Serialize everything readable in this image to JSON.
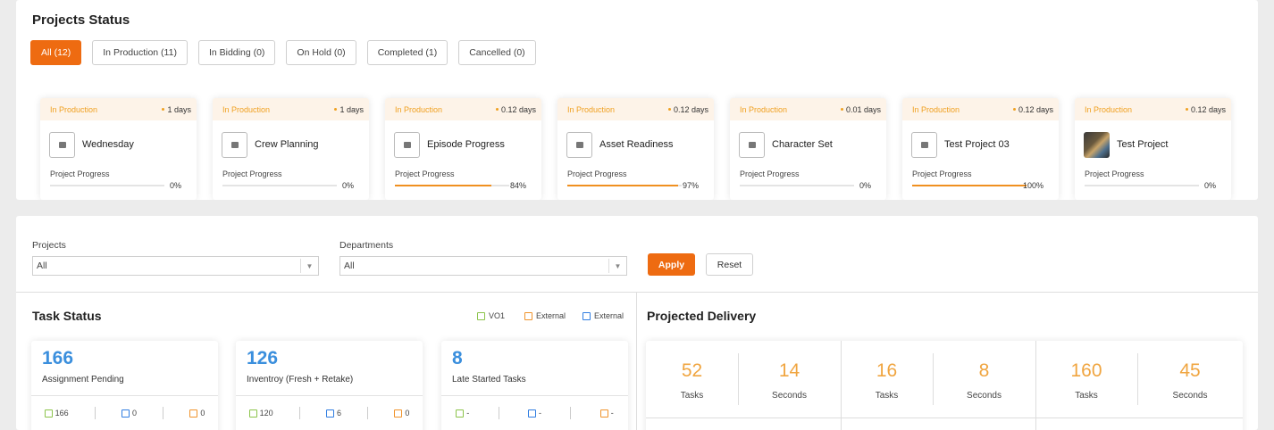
{
  "projects_status": {
    "title": "Projects Status",
    "tabs": [
      {
        "label": "All (12)",
        "active": true
      },
      {
        "label": "In Production (11)",
        "active": false
      },
      {
        "label": "In Bidding (0)",
        "active": false
      },
      {
        "label": "On Hold (0)",
        "active": false
      },
      {
        "label": "Completed (1)",
        "active": false
      },
      {
        "label": "Cancelled (0)",
        "active": false
      }
    ],
    "progress_label": "Project Progress",
    "cards": [
      {
        "status": "In Production",
        "days": "1 days",
        "name": "Wednesday",
        "progress": "0%",
        "progress_value": 0,
        "thumb": "folder-icon"
      },
      {
        "status": "In Production",
        "days": "1 days",
        "name": "Crew Planning",
        "progress": "0%",
        "progress_value": 0,
        "thumb": "folder-icon"
      },
      {
        "status": "In Production",
        "days": "0.12 days",
        "name": "Episode Progress",
        "progress": "84%",
        "progress_value": 84,
        "thumb": "folder-icon"
      },
      {
        "status": "In Production",
        "days": "0.12 days",
        "name": "Asset Readiness",
        "progress": "97%",
        "progress_value": 97,
        "thumb": "folder-icon"
      },
      {
        "status": "In Production",
        "days": "0.01 days",
        "name": "Character Set",
        "progress": "0%",
        "progress_value": 0,
        "thumb": "folder-icon"
      },
      {
        "status": "In Production",
        "days": "0.12 days",
        "name": "Test Project 03",
        "progress": "100%",
        "progress_value": 100,
        "thumb": "folder-icon"
      },
      {
        "status": "In Production",
        "days": "0.12 days",
        "name": "Test Project",
        "progress": "0%",
        "progress_value": 0,
        "thumb": "project-image"
      }
    ]
  },
  "filters": {
    "projects_label": "Projects",
    "projects_value": "All",
    "departments_label": "Departments",
    "departments_value": "All",
    "apply_label": "Apply",
    "reset_label": "Reset"
  },
  "task_status": {
    "title": "Task Status",
    "legend": [
      {
        "label": "VO1",
        "icon": "green-bracket-icon"
      },
      {
        "label": "External",
        "icon": "orange-external-icon"
      },
      {
        "label": "External",
        "icon": "blue-check-icon"
      }
    ],
    "cards": [
      {
        "number": "166",
        "label": "Assignment Pending",
        "green": "166",
        "blue": "0",
        "orange": "0"
      },
      {
        "number": "126",
        "label": "Inventroy (Fresh + Retake)",
        "green": "120",
        "blue": "6",
        "orange": "0"
      },
      {
        "number": "8",
        "label": "Late Started Tasks",
        "green": "-",
        "blue": "-",
        "orange": "-"
      }
    ]
  },
  "projected_delivery": {
    "title": "Projected Delivery",
    "cells": [
      {
        "number": "52",
        "label": "Tasks"
      },
      {
        "number": "14",
        "label": "Seconds"
      },
      {
        "number": "16",
        "label": "Tasks"
      },
      {
        "number": "8",
        "label": "Seconds"
      },
      {
        "number": "160",
        "label": "Tasks"
      },
      {
        "number": "45",
        "label": "Seconds"
      }
    ]
  },
  "colors": {
    "accent": "#ee6b11",
    "status_orange": "#f0a020",
    "task_number_blue": "#3b8fdd",
    "delivery_number": "#f0a540"
  }
}
